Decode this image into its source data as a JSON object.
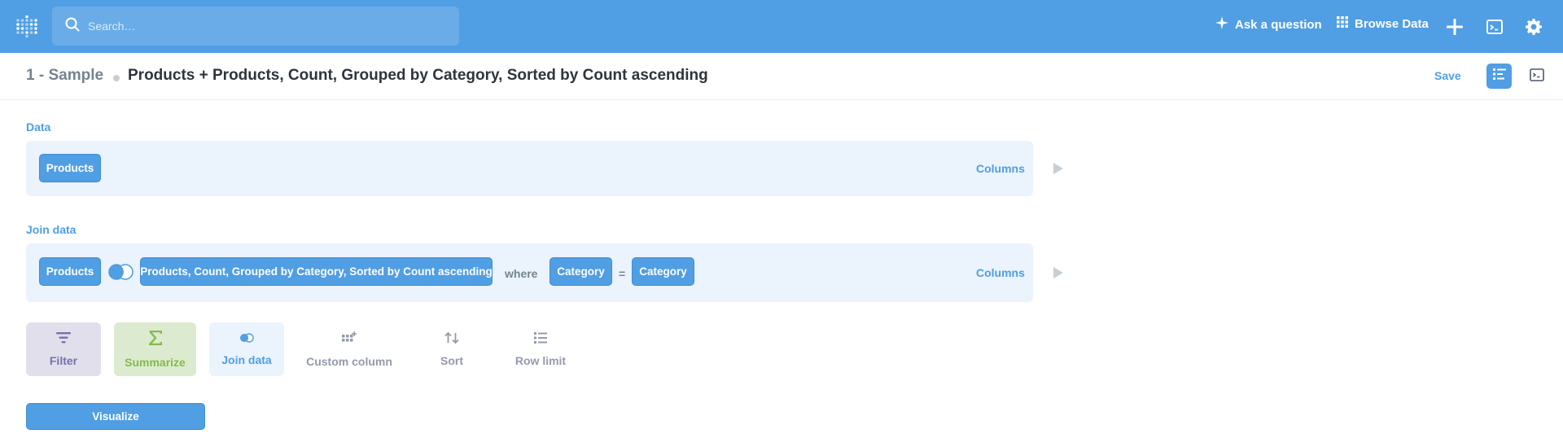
{
  "topbar": {
    "search_placeholder": "Search…",
    "ask_question": "Ask a question",
    "browse_data": "Browse Data"
  },
  "header": {
    "database": "1 - Sample",
    "title": "Products + Products, Count, Grouped by Category, Sorted by Count ascending",
    "save": "Save"
  },
  "notebook": {
    "data_step": {
      "label": "Data",
      "table": "Products",
      "columns": "Columns"
    },
    "join_step": {
      "label": "Join data",
      "left_table": "Products",
      "right_table": "Products, Count, Grouped by Category, Sorted by Count ascending",
      "where": "where",
      "left_column": "Category",
      "operator": "=",
      "right_column": "Category",
      "columns": "Columns"
    },
    "actions": {
      "filter": "Filter",
      "summarize": "Summarize",
      "join": "Join data",
      "custom_column": "Custom column",
      "sort": "Sort",
      "row_limit": "Row limit"
    },
    "visualize": "Visualize"
  },
  "colors": {
    "brand": "#509ee3",
    "filter": "#7172ad",
    "summarize": "#84bb4c"
  }
}
